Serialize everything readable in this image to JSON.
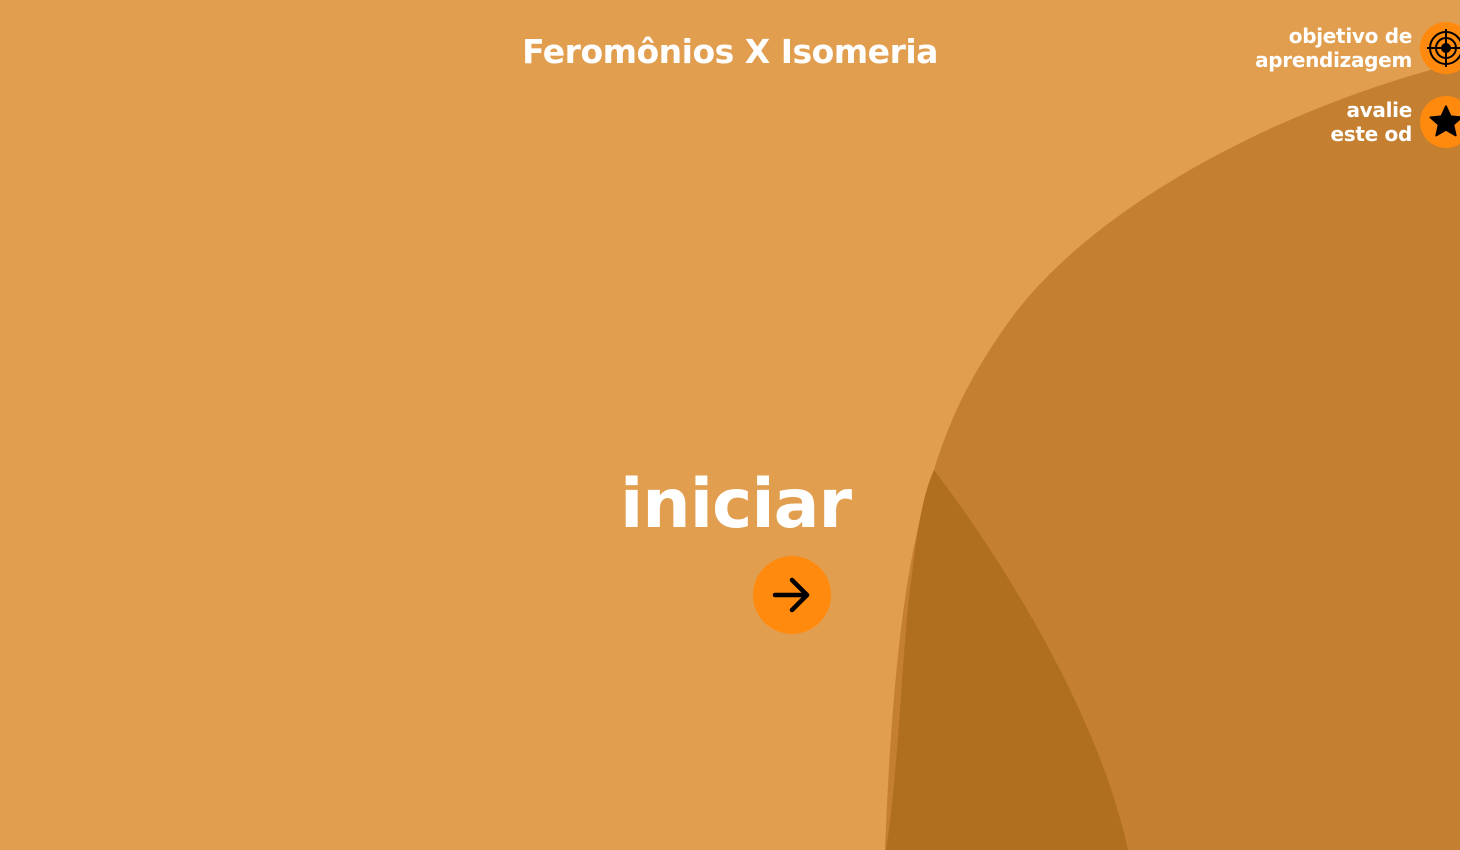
{
  "header": {
    "title": "Feromônios X Isomeria"
  },
  "side_menu": {
    "objective": {
      "line1": "objetivo de",
      "line2": "aprendizagem",
      "icon": "target-icon"
    },
    "rate": {
      "line1": "avalie",
      "line2": "este od",
      "icon": "star-icon"
    }
  },
  "main": {
    "start_label": "iniciar",
    "start_icon": "arrow-right-icon"
  },
  "colors": {
    "background": "#e29e4f",
    "shape_mid": "#c47f30",
    "shape_dark": "#b06e1f",
    "accent": "#ff8a0d",
    "text": "#ffffff"
  }
}
